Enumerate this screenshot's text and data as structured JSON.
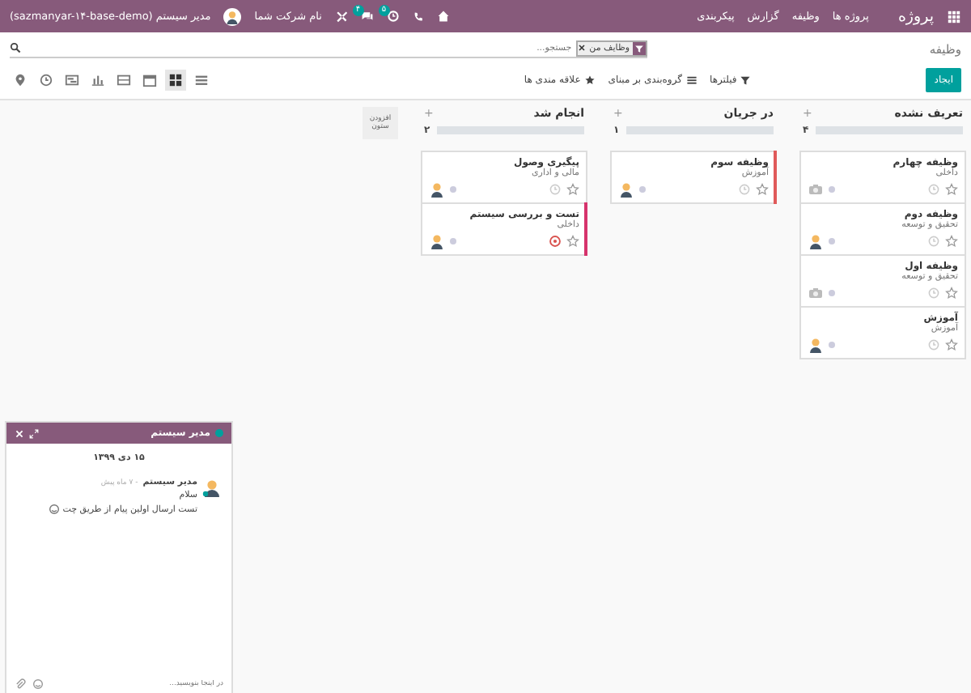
{
  "navbar": {
    "app_name": "پروژه",
    "menu": [
      "پروژه ها",
      "وظیفه",
      "گزارش",
      "پیکربندی"
    ],
    "activities_count": "۵",
    "messages_count": "۴",
    "company": "نام شرکت شما",
    "user": "مدیر سیستم (sazmanyar-۱۴-base-demo)"
  },
  "breadcrumb": "وظیفه",
  "search": {
    "facet": "وظایف من",
    "placeholder": "جستجو..."
  },
  "create_button": "ایجاد",
  "filters": [
    {
      "kind": "filter",
      "label": "فیلترها"
    },
    {
      "kind": "group",
      "label": "گروه‌بندی بر مبنای"
    },
    {
      "kind": "favorite",
      "label": "علاقه مندی ها"
    }
  ],
  "views": [
    {
      "kind": "list",
      "selected": false
    },
    {
      "kind": "kanban",
      "selected": true
    },
    {
      "kind": "calendar",
      "selected": false
    },
    {
      "kind": "pivot",
      "selected": false
    },
    {
      "kind": "graph",
      "selected": false
    },
    {
      "kind": "gantt",
      "selected": false
    },
    {
      "kind": "activity",
      "selected": false
    },
    {
      "kind": "map",
      "selected": false
    }
  ],
  "columns": [
    {
      "title": "تعریف نشده",
      "add_label": "+",
      "level": 0,
      "count": "۴",
      "cards": [
        {
          "title": "وظیفه چهارم",
          "project": "داخلی",
          "starred": false,
          "overdue": false,
          "assigned": false
        },
        {
          "title": "وظیفه دوم",
          "project": "تحقیق و توسعه",
          "starred": false,
          "overdue": false,
          "assigned": true
        },
        {
          "title": "وظیفه اول",
          "project": "تحقیق و توسعه",
          "starred": false,
          "overdue": false,
          "assigned": false
        },
        {
          "title": "آموزش",
          "project": "آموزش",
          "starred": false,
          "overdue": false,
          "assigned": true
        }
      ]
    },
    {
      "title": "در جریان",
      "add_label": "+",
      "level": 0,
      "count": "۱",
      "cards": [
        {
          "title": "وظیفه سوم",
          "project": "آموزش",
          "starred": false,
          "overdue": false,
          "assigned": true,
          "color": "#e05a5a"
        }
      ]
    },
    {
      "title": "انجام شد",
      "add_label": "+",
      "level": 0,
      "count": "۲",
      "cards": [
        {
          "title": "پیگیری وصول",
          "project": "مالی و اداری",
          "starred": false,
          "overdue": false,
          "assigned": true
        },
        {
          "title": "تست و بررسی سیستم",
          "project": "داخلی",
          "starred": false,
          "overdue": true,
          "assigned": true,
          "color": "#d6336c"
        }
      ]
    }
  ],
  "add_column": "افزودن ستون",
  "chat": {
    "title": "مدیر سیستم",
    "date": "۱۵ دی ۱۳۹۹",
    "author": "مدیر سیستم",
    "time": "- ۷ ماه پیش",
    "lines": [
      "سلام",
      "تست ارسال اولین پیام از طریق چت"
    ],
    "placeholder": "در اینجا بنویسید..."
  }
}
